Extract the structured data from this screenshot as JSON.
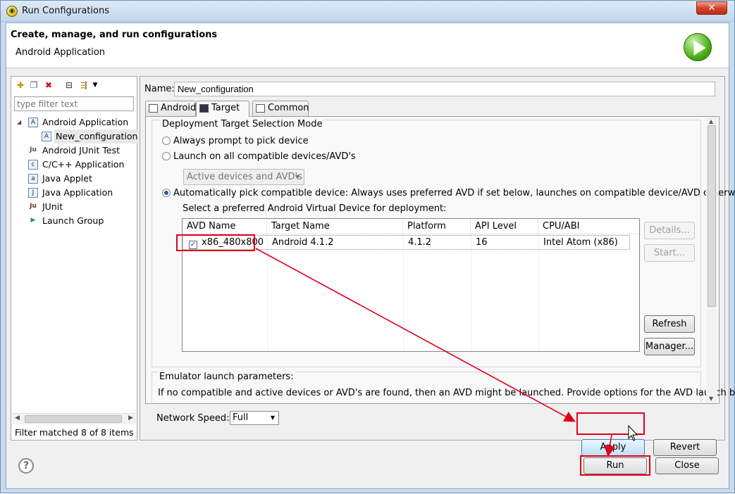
{
  "window": {
    "title": "Run Configurations",
    "close_glyph": "✕"
  },
  "header": {
    "title": "Create, manage, and run configurations",
    "subtitle": "Android Application"
  },
  "left": {
    "filter_placeholder": "type filter text",
    "tree": [
      {
        "label": "Android Application",
        "icon": "android-app-icon",
        "glyph": "A",
        "expanded": true
      },
      {
        "label": "New_configuration",
        "icon": "android-config-icon",
        "glyph": "A",
        "child": true,
        "selected": true
      },
      {
        "label": "Android JUnit Test",
        "icon": "junit-icon",
        "glyph": "Ju"
      },
      {
        "label": "C/C++ Application",
        "icon": "cpp-icon",
        "glyph": "c"
      },
      {
        "label": "Java Applet",
        "icon": "java-applet-icon",
        "glyph": "a"
      },
      {
        "label": "Java Application",
        "icon": "java-app-icon",
        "glyph": "J"
      },
      {
        "label": "JUnit",
        "icon": "junit-icon",
        "glyph": "Ju"
      },
      {
        "label": "Launch Group",
        "icon": "launch-group-icon",
        "glyph": "▶"
      }
    ],
    "status": "Filter matched 8 of 8 items"
  },
  "right": {
    "name_label": "Name:",
    "name_value": "New_configuration",
    "tabs": [
      "Android",
      "Target",
      "Common"
    ],
    "active_tab": "Target",
    "deployment": {
      "title": "Deployment Target Selection Mode",
      "opt_prompt": "Always prompt to pick device",
      "opt_all": "Launch on all compatible devices/AVD's",
      "combo_value": "Active devices and AVD's",
      "opt_auto": "Automatically pick compatible device: Always uses preferred AVD if set below, launches on compatible device/AVD otherwise.",
      "pref_label": "Select a preferred Android Virtual Device for deployment:"
    },
    "avd_table": {
      "columns": [
        "AVD Name",
        "Target Name",
        "Platform",
        "API Level",
        "CPU/ABI"
      ],
      "rows": [
        {
          "checked": true,
          "name": "x86_480x800",
          "target": "Android 4.1.2",
          "platform": "4.1.2",
          "api": "16",
          "cpu": "Intel Atom (x86)"
        }
      ]
    },
    "side_buttons": {
      "details": "Details...",
      "start": "Start...",
      "refresh": "Refresh",
      "manager": "Manager..."
    },
    "emulator": {
      "title": "Emulator launch parameters:",
      "text": "If no compatible and active devices or AVD's are found, then an AVD might be launched. Provide options for the AVD launch below.",
      "net_label": "Network Speed:",
      "net_value": "Full"
    }
  },
  "buttons": {
    "apply": "Apply",
    "revert": "Revert",
    "run": "Run",
    "close": "Close"
  },
  "annotation_color": "#e0001a"
}
